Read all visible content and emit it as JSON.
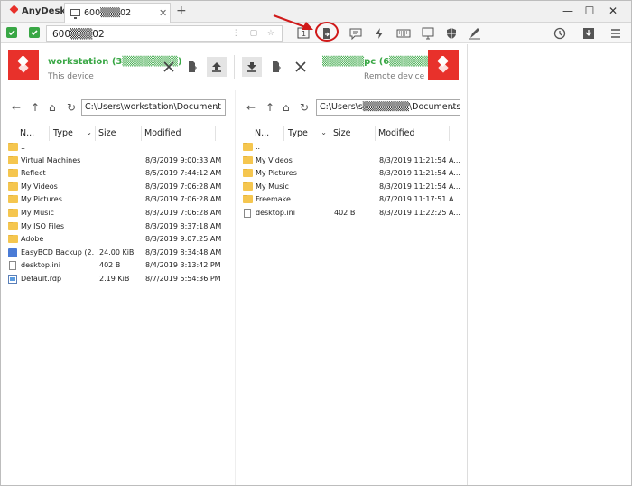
{
  "window": {
    "app_name": "AnyDesk",
    "tab_label": "600▒▒▒02",
    "tab_close": "✕",
    "tab_add": "+",
    "minimize": "—",
    "maximize": "☐",
    "close": "✕"
  },
  "address": {
    "value": "600▒▒▒02"
  },
  "toolbar": {
    "highlighted": "file-transfer",
    "accent": "#d01a1a"
  },
  "local": {
    "name": "workstation (3▒▒▒▒▒▒▒▒)",
    "subtitle": "This device",
    "path": "C:\\Users\\workstation\\Document"
  },
  "remote": {
    "name": "▒▒▒▒▒▒pc (6▒▒▒▒▒▒▒▒)",
    "subtitle": "Remote device",
    "path": "C:\\Users\\s▒▒▒▒▒▒▒\\Documents"
  },
  "columns": {
    "name": "N...",
    "type": "Type",
    "size": "Size",
    "modified": "Modified"
  },
  "dropdown_glyph": "⌄",
  "local_files": [
    {
      "icon": "folder",
      "name": "..",
      "size": "",
      "modified": ""
    },
    {
      "icon": "folder",
      "name": "Virtual Machines",
      "size": "",
      "modified": "8/3/2019 9:00:33 AM"
    },
    {
      "icon": "folder",
      "name": "Reflect",
      "size": "",
      "modified": "8/5/2019 7:44:12 AM"
    },
    {
      "icon": "folder",
      "name": "My Videos",
      "size": "",
      "modified": "8/3/2019 7:06:28 AM"
    },
    {
      "icon": "folder",
      "name": "My Pictures",
      "size": "",
      "modified": "8/3/2019 7:06:28 AM"
    },
    {
      "icon": "folder",
      "name": "My Music",
      "size": "",
      "modified": "8/3/2019 7:06:28 AM"
    },
    {
      "icon": "folder",
      "name": "My ISO Files",
      "size": "",
      "modified": "8/3/2019 8:37:18 AM"
    },
    {
      "icon": "folder",
      "name": "Adobe",
      "size": "",
      "modified": "8/3/2019 9:07:25 AM"
    },
    {
      "icon": "app",
      "name": "EasyBCD Backup (2...",
      "size": "24.00 KiB",
      "modified": "8/3/2019 8:34:48 AM"
    },
    {
      "icon": "file",
      "name": "desktop.ini",
      "size": "402 B",
      "modified": "8/4/2019 3:13:42 PM"
    },
    {
      "icon": "rdp",
      "name": "Default.rdp",
      "size": "2.19 KiB",
      "modified": "8/7/2019 5:54:36 PM"
    }
  ],
  "remote_files": [
    {
      "icon": "folder",
      "name": "..",
      "size": "",
      "modified": ""
    },
    {
      "icon": "folder",
      "name": "My Videos",
      "size": "",
      "modified": "8/3/2019 11:21:54 A..."
    },
    {
      "icon": "folder",
      "name": "My Pictures",
      "size": "",
      "modified": "8/3/2019 11:21:54 A..."
    },
    {
      "icon": "folder",
      "name": "My Music",
      "size": "",
      "modified": "8/3/2019 11:21:54 A..."
    },
    {
      "icon": "folder",
      "name": "Freemake",
      "size": "",
      "modified": "8/7/2019 11:17:51 A..."
    },
    {
      "icon": "file",
      "name": "desktop.ini",
      "size": "402 B",
      "modified": "8/3/2019 11:22:25 A..."
    }
  ]
}
